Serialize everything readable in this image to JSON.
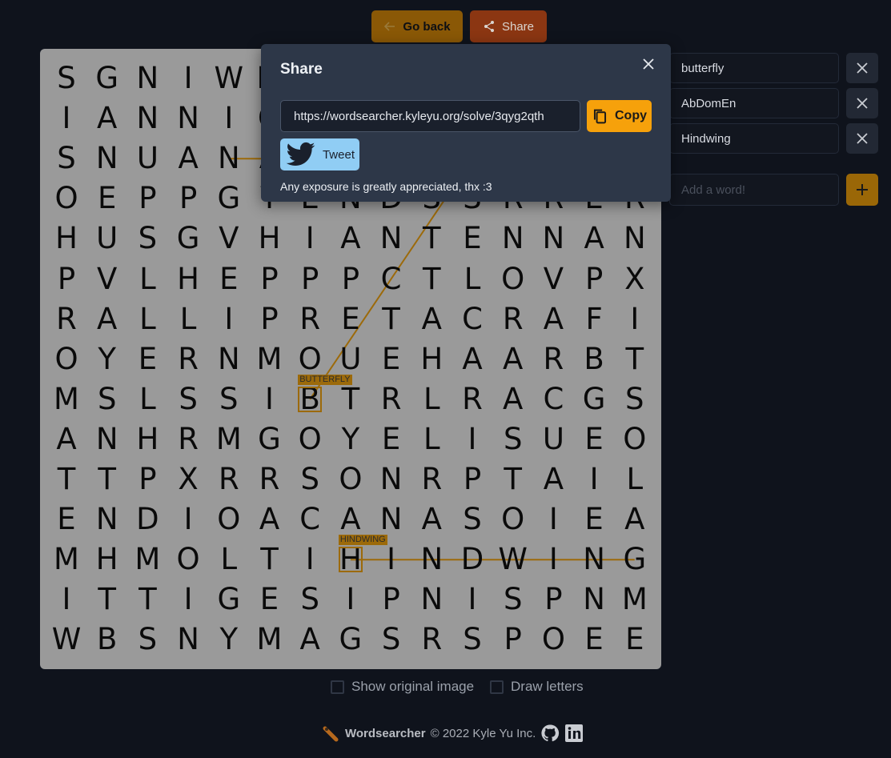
{
  "toolbar": {
    "back_label": "Go back",
    "share_label": "Share"
  },
  "grid": [
    "SGNIWMADUCSLETR",
    "IANNIOSIANTENNA",
    "SNUANAOPLEOSTHE",
    "OEPPGYENDSSRRER",
    "HUSGVHIANTENNAN",
    "PVLHEPPPCTLOVPX",
    "RALLIPRETACRAFI",
    "OYERNMOUEHAARBT",
    "MSLSSIBTRLRACGS",
    "ANHRMGOYELISUEO",
    "TTPXRRSONRPTAIL",
    "ENDIOACANASOIEA",
    "MHMOLTIHINDWING",
    "ITTIGESIPNISPNM",
    "WBSNYMAGSRSPOEE"
  ],
  "found": [
    {
      "label": "BUTTERFLY",
      "from": [
        8,
        6
      ],
      "to": [
        2,
        10
      ]
    },
    {
      "label": "HINDWING",
      "from": [
        12,
        7
      ],
      "to": [
        12,
        14
      ]
    },
    {
      "label": "ABDOMEN",
      "from": [
        2,
        4
      ],
      "to": [
        2,
        7
      ]
    }
  ],
  "words": [
    {
      "text": "butterfly"
    },
    {
      "text": "AbDomEn"
    },
    {
      "text": "Hindwing"
    }
  ],
  "add": {
    "placeholder": "Add a word!"
  },
  "modal": {
    "title": "Share",
    "url": "https://wordsearcher.kyleyu.org/solve/3qyg2qth",
    "copy_label": "Copy",
    "tweet_label": "Tweet",
    "note": "Any exposure is greatly appreciated, thx :3"
  },
  "options": {
    "original_label": "Show original image",
    "letters_label": "Draw letters"
  },
  "footer": {
    "brand": "Wordsearcher",
    "copyright": "© 2022 Kyle Yu Inc."
  },
  "colors": {
    "accent": "#f6a10b",
    "highlight": "#9c6a0a",
    "board": "#9a9a9a"
  }
}
